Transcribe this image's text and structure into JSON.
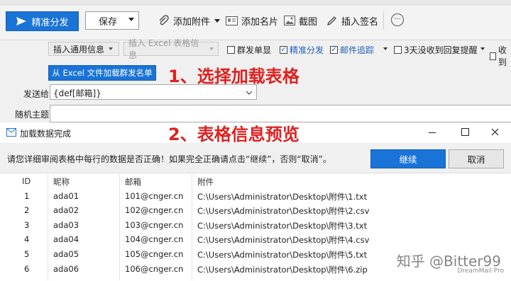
{
  "toolbar": {
    "send_label": "精准分发",
    "save_label": "保存",
    "attach_label": "添加附件",
    "card_label": "添加名片",
    "screenshot_label": "截图",
    "signature_label": "插入签名"
  },
  "options": {
    "insert_common": "插入通用信息",
    "insert_excel": "插入 Excel 表格信息",
    "group_single": "群发单显",
    "precise_send": "精准分发",
    "mail_tracking": "邮件追踪",
    "no_reply": "3天没收到回复提醒",
    "receipt": "收到"
  },
  "load_button": "从 Excel 文件加载群发名单",
  "annotations": {
    "step1": "1、选择加载表格",
    "step2": "2、表格信息预览"
  },
  "form": {
    "to_label": "发送给",
    "to_value": "{def[邮箱]}",
    "subject_label": "随机主题"
  },
  "dialog": {
    "title": "加载数据完成",
    "message": "请您详细审阅表格中每行的数据是否正确！如果完全正确请点击“继续”，否则“取消”。",
    "continue_label": "继续",
    "cancel_label": "取消",
    "columns": [
      "ID",
      "昵称",
      "邮箱",
      "附件"
    ],
    "rows": [
      [
        "1",
        "ada01",
        "101@cnger.cn",
        "C:\\Users\\Administrator\\Desktop\\附件\\1.txt"
      ],
      [
        "2",
        "ada02",
        "102@cnger.cn",
        "C:\\Users\\Administrator\\Desktop\\附件\\2.csv"
      ],
      [
        "3",
        "ada03",
        "103@cnger.cn",
        "C:\\Users\\Administrator\\Desktop\\附件\\3.txt"
      ],
      [
        "4",
        "ada04",
        "104@cnger.cn",
        "C:\\Users\\Administrator\\Desktop\\附件\\4.csv"
      ],
      [
        "5",
        "ada05",
        "105@cnger.cn",
        "C:\\Users\\Administrator\\Desktop\\附件\\5.txt"
      ],
      [
        "6",
        "ada06",
        "106@cnger.cn",
        "C:\\Users\\Administrator\\Desktop\\附件\\6.zip"
      ]
    ]
  },
  "watermark": "知乎 @Bitter99",
  "watermark_app": "DreamMail Pro",
  "colors": {
    "accent": "#1a73d6",
    "annotation": "#e02020"
  }
}
